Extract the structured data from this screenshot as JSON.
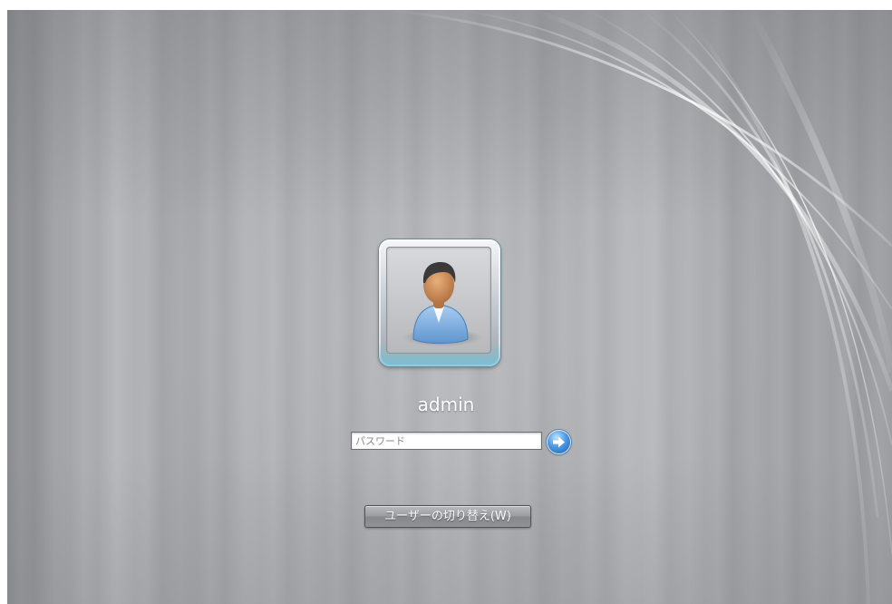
{
  "user": {
    "name": "admin",
    "avatar_icon": "user-avatar-icon"
  },
  "password": {
    "placeholder": "パスワード",
    "value": ""
  },
  "submit": {
    "icon": "arrow-right-icon"
  },
  "switch_user": {
    "label": "ユーザーの切り替え(W)"
  },
  "colors": {
    "background": "#a9aaad",
    "submit_blue": "#1b5fb6",
    "text": "#ffffff"
  }
}
